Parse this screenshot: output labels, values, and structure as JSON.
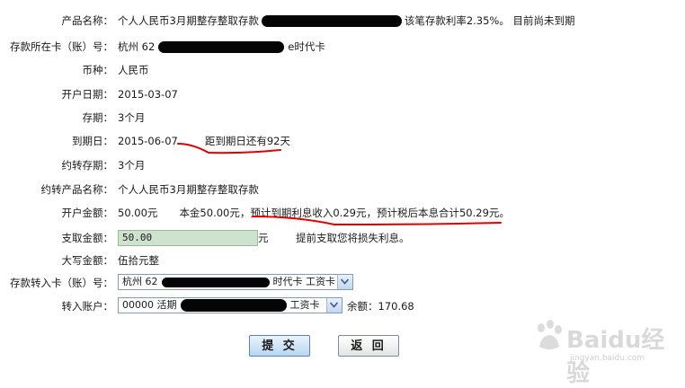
{
  "rows": {
    "product": {
      "label": "产品名称：",
      "prefix": "个人人民币3月期整存整取存款",
      "suffix": "该笔存款利率2.35%。  目前尚未到期"
    },
    "card": {
      "label": "存款所在卡（账）号：",
      "prefix": "杭州 62",
      "suffix": "e时代卡"
    },
    "currency": {
      "label": "币种：",
      "value": "人民币"
    },
    "open_date": {
      "label": "开户日期：",
      "value": "2015-03-07"
    },
    "term": {
      "label": "存期：",
      "value": "3个月"
    },
    "due_date": {
      "label": "到期日：",
      "value": "2015-06-07",
      "note": "距到期日还有92天"
    },
    "renew_term": {
      "label": "约转存期：",
      "value": "3个月"
    },
    "renew_product": {
      "label": "约转产品名称：",
      "value": "个人人民币3月期整存整取存款"
    },
    "open_amount": {
      "label": "开户金额：",
      "value": "50.00元",
      "principal": "本金50.00元，",
      "interest": "预计到期利息收入0.29元，预计税后本息合计50.29元。"
    },
    "withdraw": {
      "label": "支取金额：",
      "value": "50.00",
      "unit": "元",
      "hint": "提前支取您将损失利息。"
    },
    "upper_amount": {
      "label": "大写金额：",
      "value": "伍拾元整"
    },
    "transfer_card": {
      "label": "存款转入卡（账）号：",
      "prefix": "杭州 62",
      "suffix": "时代卡 工资卡"
    },
    "transfer_account": {
      "label": "转入账户：",
      "prefix": "00000 活期",
      "suffix": "工资卡",
      "balance": "余额：170.68"
    }
  },
  "buttons": {
    "submit": "提 交",
    "back": "返 回"
  },
  "watermark": {
    "brand": "Baidu经验",
    "url": "jingyan.baidu.com"
  },
  "colors": {
    "annotation_red": "#e00000",
    "input_bg": "#cde3cd",
    "submit_bg": "#b8d6f2"
  }
}
